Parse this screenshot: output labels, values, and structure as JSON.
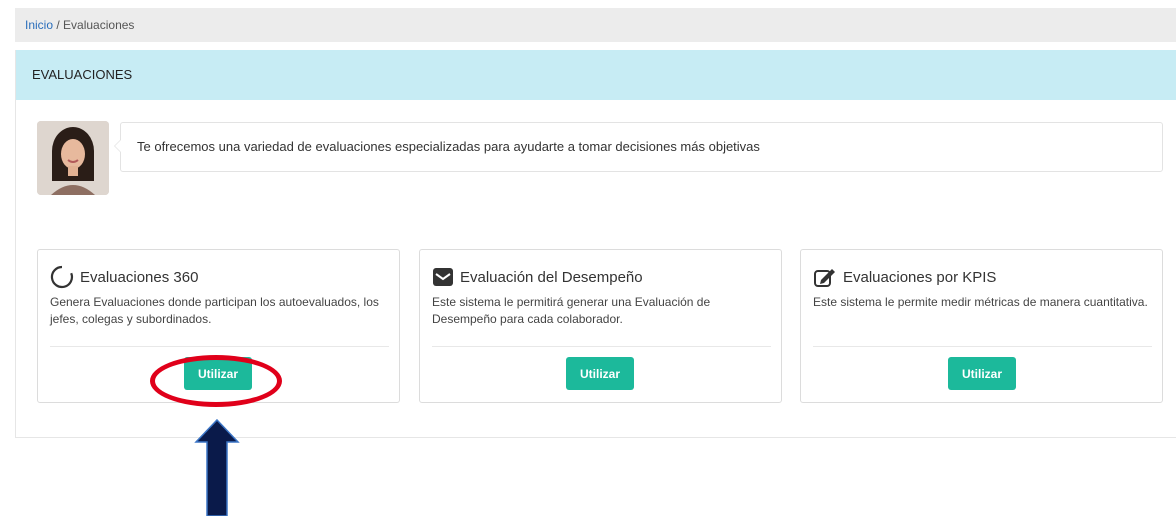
{
  "breadcrumb": {
    "home": "Inicio",
    "separator": " / ",
    "current": "Evaluaciones"
  },
  "panel": {
    "title": "EVALUACIONES"
  },
  "intro": {
    "message": "Te ofrecemos una variedad de evaluaciones especializadas para ayudarte a tomar decisiones más objetivas"
  },
  "cards": [
    {
      "title": "Evaluaciones 360",
      "icon": "circle-notch-icon",
      "description": "Genera Evaluaciones donde participan los autoevaluados, los jefes, colegas y subordinados.",
      "button": "Utilizar"
    },
    {
      "title": "Evaluación del Desempeño",
      "icon": "envelope-icon",
      "description": "Este sistema le permitirá generar una Evaluación de Desempeño para cada colaborador.",
      "button": "Utilizar"
    },
    {
      "title": "Evaluaciones por KPIS",
      "icon": "edit-icon",
      "description": "Este sistema le permite medir métricas de manera cuantitativa.",
      "button": "Utilizar"
    }
  ],
  "colors": {
    "accent_button": "#1cb99b",
    "panel_header": "#c7ecf4",
    "annotation": "#e0001a",
    "arrow": "#0a1a4a"
  }
}
